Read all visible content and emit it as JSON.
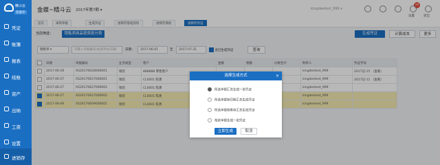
{
  "app": {
    "logo_line1": "精斗云",
    "logo_line2": "云会计",
    "brand": "金蝶~精斗云",
    "period": "2017年第7期 ▾",
    "user": "kingdeetest_999 ▾"
  },
  "topbar": {
    "help_label": "",
    "messages_label": "",
    "badge_count": "16",
    "settings_label": "设置",
    "logout_label": "退出"
  },
  "sidebar": {
    "items": [
      {
        "label": "凭证"
      },
      {
        "label": "账簿"
      },
      {
        "label": "报表"
      },
      {
        "label": "结账"
      },
      {
        "label": "资产"
      },
      {
        "label": "出纳"
      },
      {
        "label": "工资"
      },
      {
        "label": "设置"
      },
      {
        "label": "进销存"
      }
    ]
  },
  "tabs": [
    "首页",
    "采购单据",
    "生成凭证",
    "进销存基础资料",
    "进销存期初",
    "进销存凭证"
  ],
  "toolbar": {
    "current_label": "当前筛选：",
    "filter_chip": "销售类商品按类别分类",
    "generate": "生成凭证",
    "calc_cost": "计算成本",
    "more": "更多"
  },
  "filter": {
    "type_value": "销售单 ▾",
    "search_placeholder": "可输入单据编号\\往来单位\\日期",
    "date_label": "日期：",
    "date_from": "2017-06-01",
    "to": "至",
    "date_to": "2017-07-31",
    "include_label": "含已生成凭证",
    "query": "查询"
  },
  "table": {
    "headers": [
      "",
      "日期",
      "单据编号",
      "业务类型",
      "客户",
      "金额",
      "税额",
      "价税合计",
      "制单人",
      "凭证字号"
    ],
    "rows": [
      {
        "checked": false,
        "date": "2017-06-28",
        "no": "XS20170628000001",
        "type": "销货",
        "customer": "888888 零售客户",
        "amount": "",
        "tax": "",
        "total": "",
        "maker": "kingdeetest_999",
        "voucher": "2017记-15 （查看）",
        "highlight": false
      },
      {
        "checked": false,
        "date": "2017-06-27",
        "no": "XS20170627000001",
        "type": "销货",
        "customer": "CL0001 陈勇",
        "amount": "",
        "tax": "",
        "total": "40",
        "maker": "kingdeetest_999",
        "voucher": "2017记-11 （查看）",
        "highlight": false
      },
      {
        "checked": false,
        "date": "2017-06-27",
        "no": "XS20170627000002",
        "type": "销货",
        "customer": "CL0001 陈勇",
        "amount": "",
        "tax": "",
        "total": "",
        "maker": "kingdeetest_999",
        "voucher": "",
        "highlight": false
      },
      {
        "checked": true,
        "date": "2017-06-27",
        "no": "XS20170627000002",
        "type": "销货",
        "customer": "CL0001 陈勇",
        "amount": "",
        "tax": "",
        "total": "",
        "maker": "kingdeetest_999",
        "voucher": "",
        "highlight": true
      },
      {
        "checked": true,
        "date": "2017-06-09",
        "no": "XS20170609000001",
        "type": "销货",
        "customer": "CL0001 陈勇",
        "amount": "",
        "tax": "",
        "total": "",
        "maker": "kingdeetest_999",
        "voucher": "",
        "highlight": true
      }
    ]
  },
  "modal": {
    "title": "选择生成方式",
    "options": [
      "所选单据汇总生成一张凭证",
      "所选单据按日期汇总生成凭证",
      "所选单据按客商汇总生成凭证",
      "每张单据生成一张凭证"
    ],
    "selected_index": 0,
    "confirm": "立即生成",
    "cancel": "取消"
  }
}
